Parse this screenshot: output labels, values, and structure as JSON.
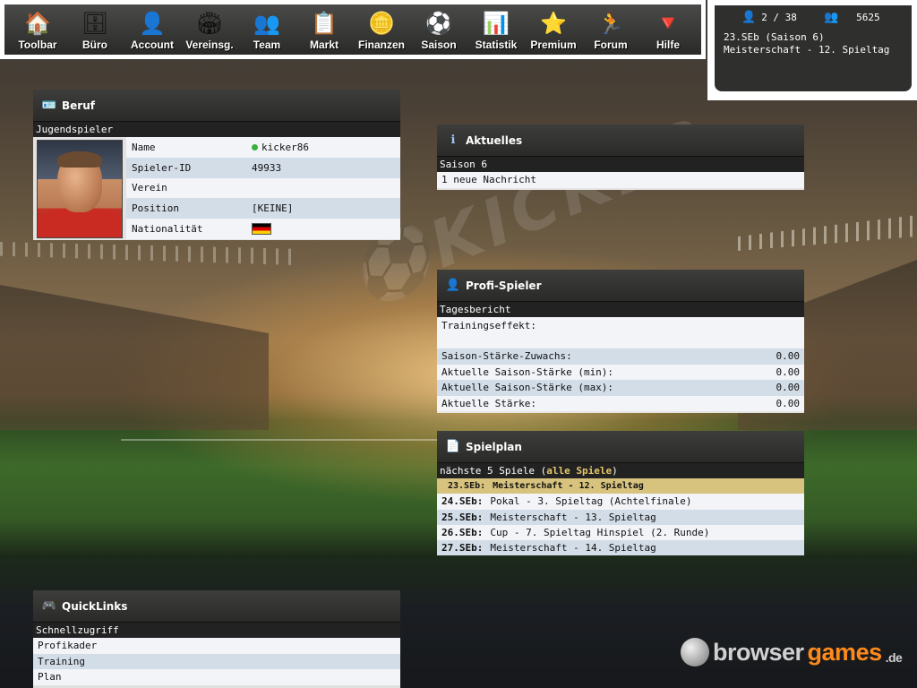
{
  "toolbar": {
    "items": [
      {
        "label": "Toolbar",
        "icon": "house-icon",
        "glyph": "🏠"
      },
      {
        "label": "Büro",
        "icon": "office-icon",
        "glyph": "🗄"
      },
      {
        "label": "Account",
        "icon": "account-icon",
        "glyph": "👤"
      },
      {
        "label": "Vereinsg.",
        "icon": "stadium-icon",
        "glyph": "🏟"
      },
      {
        "label": "Team",
        "icon": "team-icon",
        "glyph": "👥"
      },
      {
        "label": "Markt",
        "icon": "market-icon",
        "glyph": "📋"
      },
      {
        "label": "Finanzen",
        "icon": "coins-icon",
        "glyph": "🪙"
      },
      {
        "label": "Saison",
        "icon": "football-icon",
        "glyph": "⚽"
      },
      {
        "label": "Statistik",
        "icon": "chart-icon",
        "glyph": "📊"
      },
      {
        "label": "Premium",
        "icon": "star-icon",
        "glyph": "⭐"
      },
      {
        "label": "Forum",
        "icon": "forum-icon",
        "glyph": "🏃"
      },
      {
        "label": "Hilfe",
        "icon": "help-icon",
        "glyph": "🔻"
      }
    ]
  },
  "status": {
    "players_count": "2 / 38",
    "money": "5625",
    "line1": "23.SEb (Saison 6)",
    "line2": "Meisterschaft - 12. Spieltag"
  },
  "beruf": {
    "title": "Beruf",
    "subtitle": "Jugendspieler",
    "rows": [
      {
        "key": "Name",
        "value": "kicker86"
      },
      {
        "key": "Spieler-ID",
        "value": "49933"
      },
      {
        "key": "Verein",
        "value": ""
      },
      {
        "key": "Position",
        "value": "[KEINE]"
      },
      {
        "key": "Nationalität",
        "value": ""
      }
    ]
  },
  "aktuelles": {
    "title": "Aktuelles",
    "subtitle": "Saison 6",
    "message": "1 neue Nachricht"
  },
  "profi": {
    "title": "Profi-Spieler",
    "subtitle": "Tagesbericht",
    "training_label": "Trainingseffekt:",
    "rows": [
      {
        "key": "Saison-Stärke-Zuwachs:",
        "value": "0.00"
      },
      {
        "key": "Aktuelle Saison-Stärke (min):",
        "value": "0.00"
      },
      {
        "key": "Aktuelle Saison-Stärke (max):",
        "value": "0.00"
      },
      {
        "key": "Aktuelle Stärke:",
        "value": "0.00"
      }
    ]
  },
  "spielplan": {
    "title": "Spielplan",
    "subtitle_prefix": "nächste 5 Spiele (",
    "subtitle_link": "alle Spiele",
    "subtitle_suffix": ")",
    "matches": [
      {
        "team": "23.SEb:",
        "desc": "Meisterschaft - 12. Spieltag"
      },
      {
        "team": "24.SEb:",
        "desc": "Pokal - 3. Spieltag (Achtelfinale)"
      },
      {
        "team": "25.SEb:",
        "desc": "Meisterschaft - 13. Spieltag"
      },
      {
        "team": "26.SEb:",
        "desc": "Cup - 7. Spieltag Hinspiel (2. Runde)"
      },
      {
        "team": "27.SEb:",
        "desc": "Meisterschaft - 14. Spieltag"
      }
    ]
  },
  "quicklinks": {
    "title": "QuickLinks",
    "subtitle": "Schnellzugriff",
    "items": [
      "Profikader",
      "Training",
      "Plan"
    ]
  },
  "logo": {
    "part1": "browser",
    "part2": "games",
    "part3": ".de"
  }
}
